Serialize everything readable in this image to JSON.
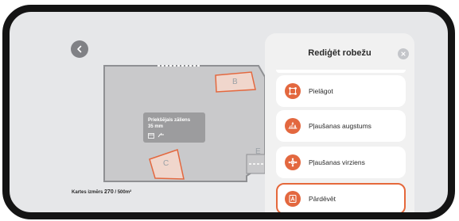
{
  "map": {
    "zone_b": "B",
    "zone_c": "C",
    "zone_e": "E",
    "lawn_card": {
      "name": "Priekšējais zāliens",
      "height": "35 mm"
    },
    "map_size": {
      "label": "Kartes izmērs",
      "value": "270",
      "unit": "/ 500m²"
    }
  },
  "panel": {
    "title": "Rediģēt robežu",
    "items": [
      {
        "label": "Pielāgot",
        "icon": "adjust-icon"
      },
      {
        "label": "Pļaušanas augstums",
        "icon": "mowing-height-icon"
      },
      {
        "label": "Pļaušanas virziens",
        "icon": "mowing-direction-icon"
      },
      {
        "label": "Pārdēvēt",
        "icon": "rename-icon",
        "selected": true
      }
    ]
  },
  "colors": {
    "accent": "#e3683f",
    "highlight_border": "#e5683b",
    "map_zone": "#c9c9cb",
    "map_outline": "#8f9093",
    "frame": "#141414"
  }
}
